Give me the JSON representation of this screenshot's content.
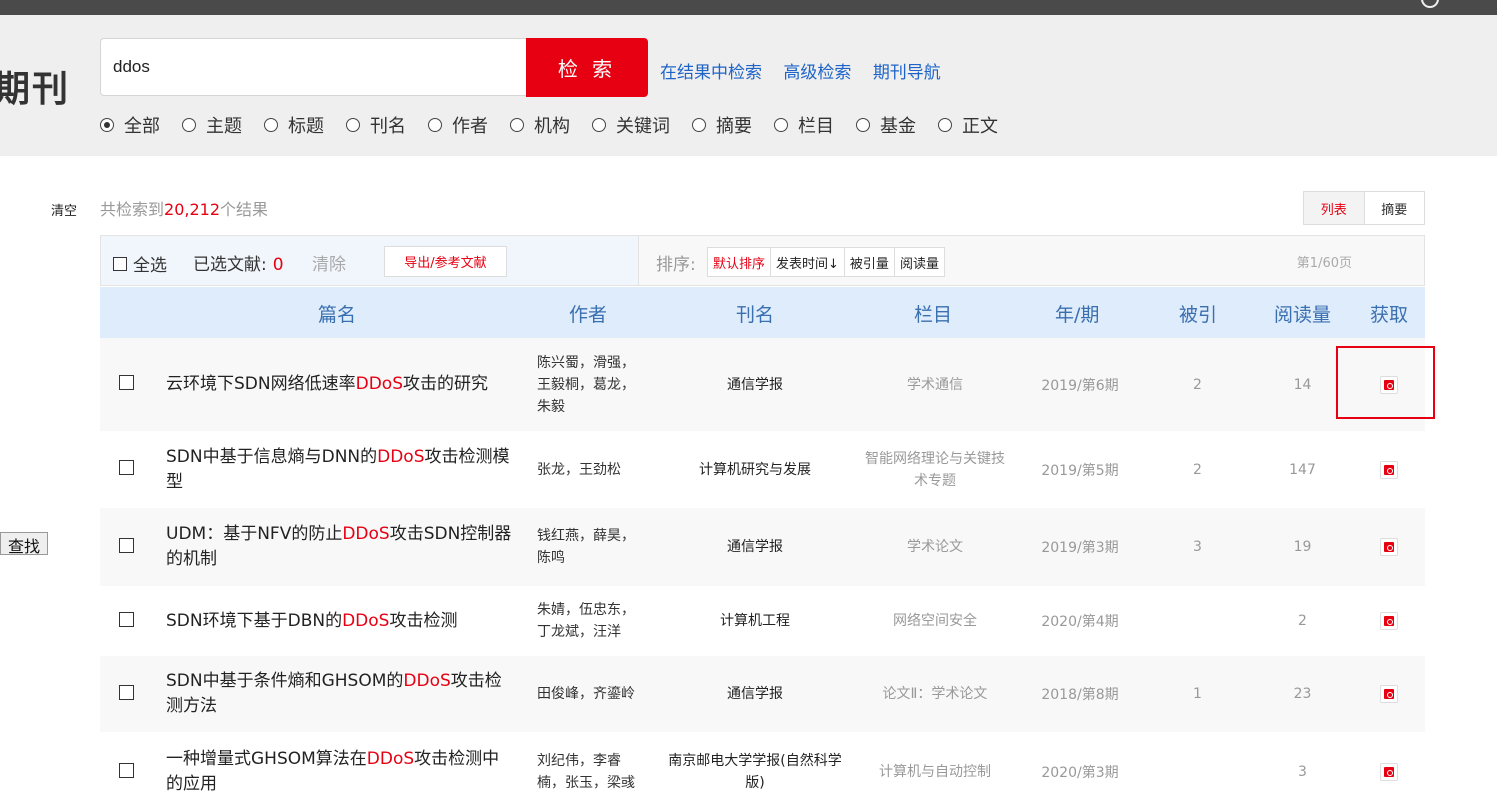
{
  "brand": "期刊",
  "search": {
    "query": "ddos",
    "button": "检 索"
  },
  "top_links": [
    "在结果中检索",
    "高级检索",
    "期刊导航"
  ],
  "search_fields": [
    {
      "label": "全部",
      "checked": true
    },
    {
      "label": "主题",
      "checked": false
    },
    {
      "label": "标题",
      "checked": false
    },
    {
      "label": "刊名",
      "checked": false
    },
    {
      "label": "作者",
      "checked": false
    },
    {
      "label": "机构",
      "checked": false
    },
    {
      "label": "关键词",
      "checked": false
    },
    {
      "label": "摘要",
      "checked": false
    },
    {
      "label": "栏目",
      "checked": false
    },
    {
      "label": "基金",
      "checked": false
    },
    {
      "label": "正文",
      "checked": false
    }
  ],
  "sidebar": {
    "clear": "清空",
    "find": "查找"
  },
  "results": {
    "prefix": "共检索到",
    "count": "20,212",
    "suffix": "个结果"
  },
  "view_toggle": {
    "list": "列表",
    "abstract": "摘要",
    "active": "列表"
  },
  "toolbar": {
    "select_all": "全选",
    "selected_label": "已选文献:",
    "selected_count": "0",
    "clear": "清除",
    "export": "导出/参考文献",
    "sort_label": "排序:",
    "sort_options": [
      "默认排序",
      "发表时间↓",
      "被引量",
      "阅读量"
    ],
    "active_sort": "默认排序",
    "page_info": "第1/60页"
  },
  "table": {
    "headers": {
      "title": "篇名",
      "author": "作者",
      "journal": "刊名",
      "column": "栏目",
      "issue": "年/期",
      "cited": "被引",
      "reads": "阅读量",
      "get": "获取"
    },
    "rows": [
      {
        "title_pre": "云环境下SDN网络低速率",
        "title_hl": "DDoS",
        "title_post": "攻击的研究",
        "authors": "陈兴蜀，滑强，王毅桐，葛龙，朱毅",
        "journal": "通信学报",
        "column": "学术通信",
        "issue": "2019/第6期",
        "cited": "2",
        "reads": "14",
        "height": 93
      },
      {
        "title_pre": "SDN中基于信息熵与DNN的",
        "title_hl": "DDoS",
        "title_post": "攻击检测模型",
        "authors": "张龙，王劲松",
        "journal": "计算机研究与发展",
        "column": "智能网络理论与关键技术专题",
        "issue": "2019/第5期",
        "cited": "2",
        "reads": "147",
        "height": 77
      },
      {
        "title_pre": "UDM：基于NFV的防止",
        "title_hl": "DDoS",
        "title_post": "攻击SDN控制器的机制",
        "authors": "钱红燕，薛昊，陈鸣",
        "journal": "通信学报",
        "column": "学术论文",
        "issue": "2019/第3期",
        "cited": "3",
        "reads": "19",
        "height": 78
      },
      {
        "title_pre": "SDN环境下基于DBN的",
        "title_hl": "DDoS",
        "title_post": "攻击检测",
        "authors": "朱婧，伍忠东，丁龙斌，汪洋",
        "journal": "计算机工程",
        "column": "网络空间安全",
        "issue": "2020/第4期",
        "cited": "",
        "reads": "2",
        "height": 70
      },
      {
        "title_pre": "SDN中基于条件熵和GHSOM的",
        "title_hl": "DDoS",
        "title_post": "攻击检测方法",
        "authors": "田俊峰，齐鎏岭",
        "journal": "通信学报",
        "column": "论文Ⅱ：学术论文",
        "issue": "2018/第8期",
        "cited": "1",
        "reads": "23",
        "height": 76
      },
      {
        "title_pre": "一种增量式GHSOM算法在",
        "title_hl": "DDoS",
        "title_post": "攻击检测中的应用",
        "authors": "刘纪伟，李睿楠，张玉，梁彧",
        "journal": "南京邮电大学学报(自然科学版)",
        "column": "计算机与自动控制",
        "issue": "2020/第3期",
        "cited": "",
        "reads": "3",
        "height": 80
      }
    ]
  }
}
